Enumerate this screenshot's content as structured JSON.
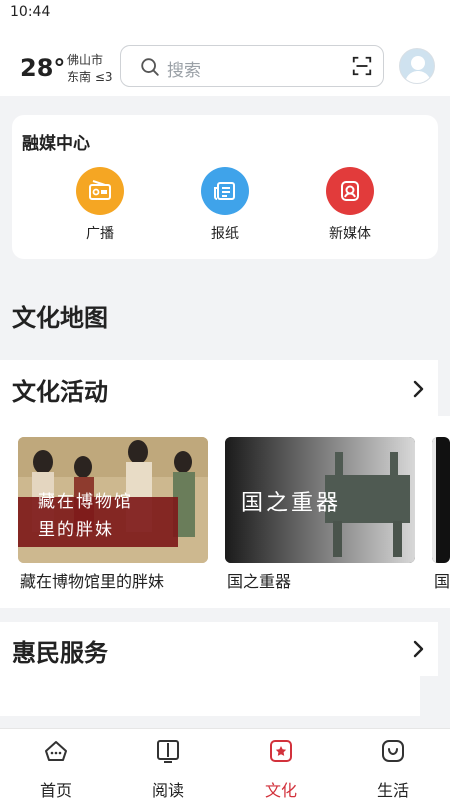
{
  "status_bar": {
    "time": "10:44"
  },
  "header": {
    "weather": {
      "temperature": "28°",
      "city": "佛山市",
      "wind": "东南 ≤3"
    },
    "search": {
      "placeholder": "搜索"
    }
  },
  "media_center": {
    "title": "融媒中心",
    "items": [
      {
        "label": "广播",
        "icon": "radio-icon",
        "color": "#f5a623"
      },
      {
        "label": "报纸",
        "icon": "newspaper-icon",
        "color": "#3fa3ea"
      },
      {
        "label": "新媒体",
        "icon": "new-media-icon",
        "color": "#e23b3b"
      }
    ]
  },
  "sections": {
    "culture_map": {
      "title": "文化地图"
    },
    "culture_activities": {
      "title": "文化活动",
      "cards": [
        {
          "image_text_line1": "藏在博物馆",
          "image_text_line2": "里的胖妹",
          "caption": "藏在博物馆里的胖妹"
        },
        {
          "image_text": "国之重器",
          "caption": "国之重器"
        },
        {
          "caption": "国"
        }
      ]
    },
    "public_services": {
      "title": "惠民服务"
    }
  },
  "bottom_nav": {
    "active_color": "#d2323c",
    "items": [
      {
        "label": "首页",
        "icon": "home-icon",
        "active": false
      },
      {
        "label": "阅读",
        "icon": "book-icon",
        "active": false
      },
      {
        "label": "文化",
        "icon": "culture-icon",
        "active": true
      },
      {
        "label": "生活",
        "icon": "life-icon",
        "active": false
      }
    ]
  }
}
